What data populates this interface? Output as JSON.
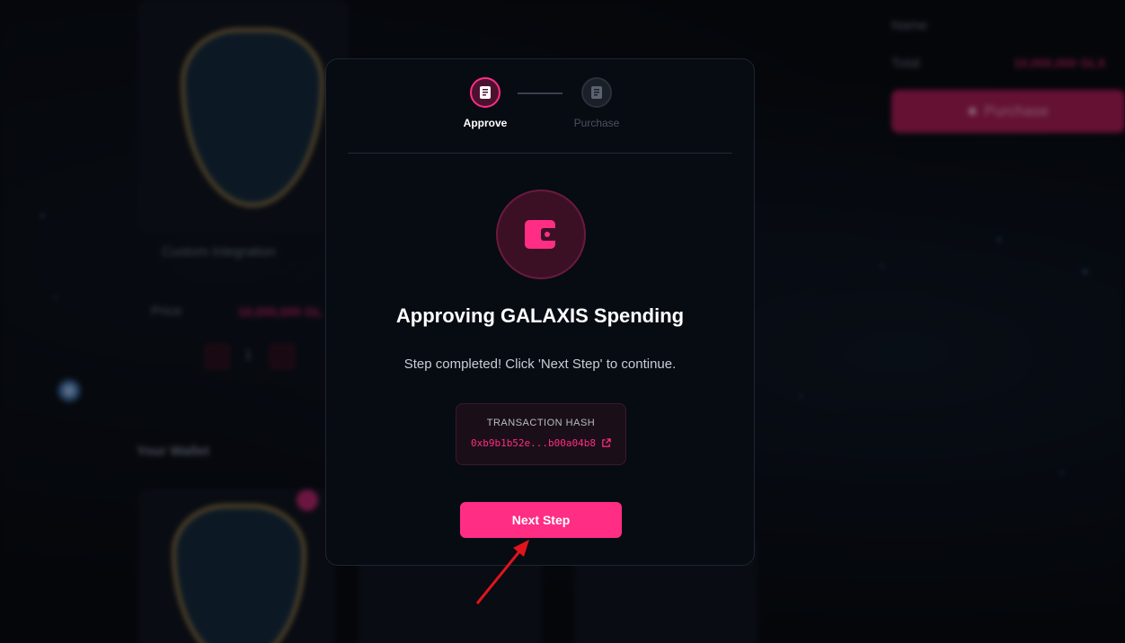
{
  "background": {
    "card_title": "Custom Integration",
    "price_label": "Price",
    "price_value": "10,000,000 GLX",
    "quantity": "1",
    "wallet_heading": "Your Wallet",
    "name_label": "Name",
    "total_label": "Total",
    "total_value": "10,000,000 GLX",
    "purchase_button": "Purchase"
  },
  "modal": {
    "steps": [
      {
        "label": "Approve",
        "state": "active",
        "icon": "document-icon"
      },
      {
        "label": "Purchase",
        "state": "inactive",
        "icon": "document-icon"
      }
    ],
    "wallet_icon": "wallet-icon",
    "title": "Approving GALAXIS Spending",
    "subtitle": "Step completed! Click 'Next Step' to continue.",
    "hash_label": "TRANSACTION HASH",
    "hash_value": "0xb9b1b52e...b00a04b8",
    "external_link_icon": "external-link-icon",
    "next_button": "Next Step"
  },
  "colors": {
    "accent": "#ff2d83",
    "modal_bg": "#070b12",
    "annotation_arrow": "#e0141e"
  }
}
